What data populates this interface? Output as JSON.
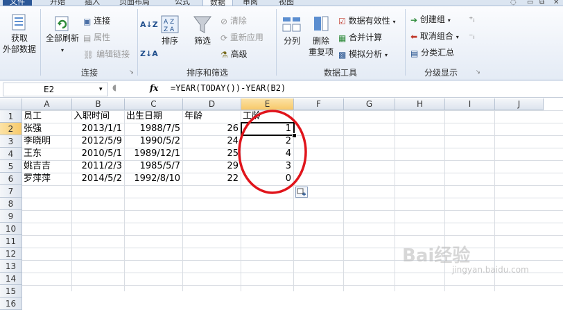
{
  "tabs": [
    "文件",
    "开始",
    "插入",
    "页面布局",
    "公式",
    "数据",
    "审阅",
    "视图"
  ],
  "active_tab": "数据",
  "ribbon": {
    "get_external_data": [
      "获取",
      "外部数据"
    ],
    "refresh_all": "全部刷新",
    "connections": "连接",
    "properties": "属性",
    "edit_links": "编辑链接",
    "group_connections": "连接",
    "sort_az": "A↓Z",
    "sort_za": "Z↓A",
    "sort": "排序",
    "filter": "筛选",
    "clear": "清除",
    "reapply": "重新应用",
    "advanced": "高级",
    "group_sort_filter": "排序和筛选",
    "text_to_columns": "分列",
    "remove_duplicates": [
      "删除",
      "重复项"
    ],
    "data_validation": "数据有效性",
    "consolidate": "合并计算",
    "what_if": "模拟分析",
    "group_data_tools": "数据工具",
    "group_create": "创建组",
    "ungroup": "取消组合",
    "subtotal": "分类汇总",
    "group_outline": "分级显示"
  },
  "namebox": "E2",
  "fx": "fx",
  "formula": "=YEAR(TODAY())-YEAR(B2)",
  "columns": [
    "A",
    "B",
    "C",
    "D",
    "E",
    "F",
    "G",
    "H",
    "I",
    "J"
  ],
  "rows": [
    "1",
    "2",
    "3",
    "4",
    "5",
    "6",
    "7",
    "8",
    "9",
    "10",
    "11",
    "12",
    "13",
    "14",
    "15",
    "16"
  ],
  "header_row": [
    "员工",
    "入职时间",
    "出生日期",
    "年龄",
    "工龄"
  ],
  "data_rows": [
    [
      "张强",
      "2013/1/1",
      "1988/7/5",
      "26",
      "1"
    ],
    [
      "李晓明",
      "2012/5/9",
      "1990/5/2",
      "24",
      "2"
    ],
    [
      "王东",
      "2010/5/1",
      "1989/12/1",
      "25",
      "4"
    ],
    [
      "姚吉吉",
      "2011/2/3",
      "1985/5/7",
      "29",
      "3"
    ],
    [
      "罗萍萍",
      "2014/5/2",
      "1992/8/10",
      "22",
      "0"
    ]
  ],
  "watermark": "Bai经验",
  "watermark_url": "jingyan.baidu.com",
  "colors": {
    "accent": "#2b5797",
    "selection": "#000000",
    "oval": "#e0141b"
  }
}
